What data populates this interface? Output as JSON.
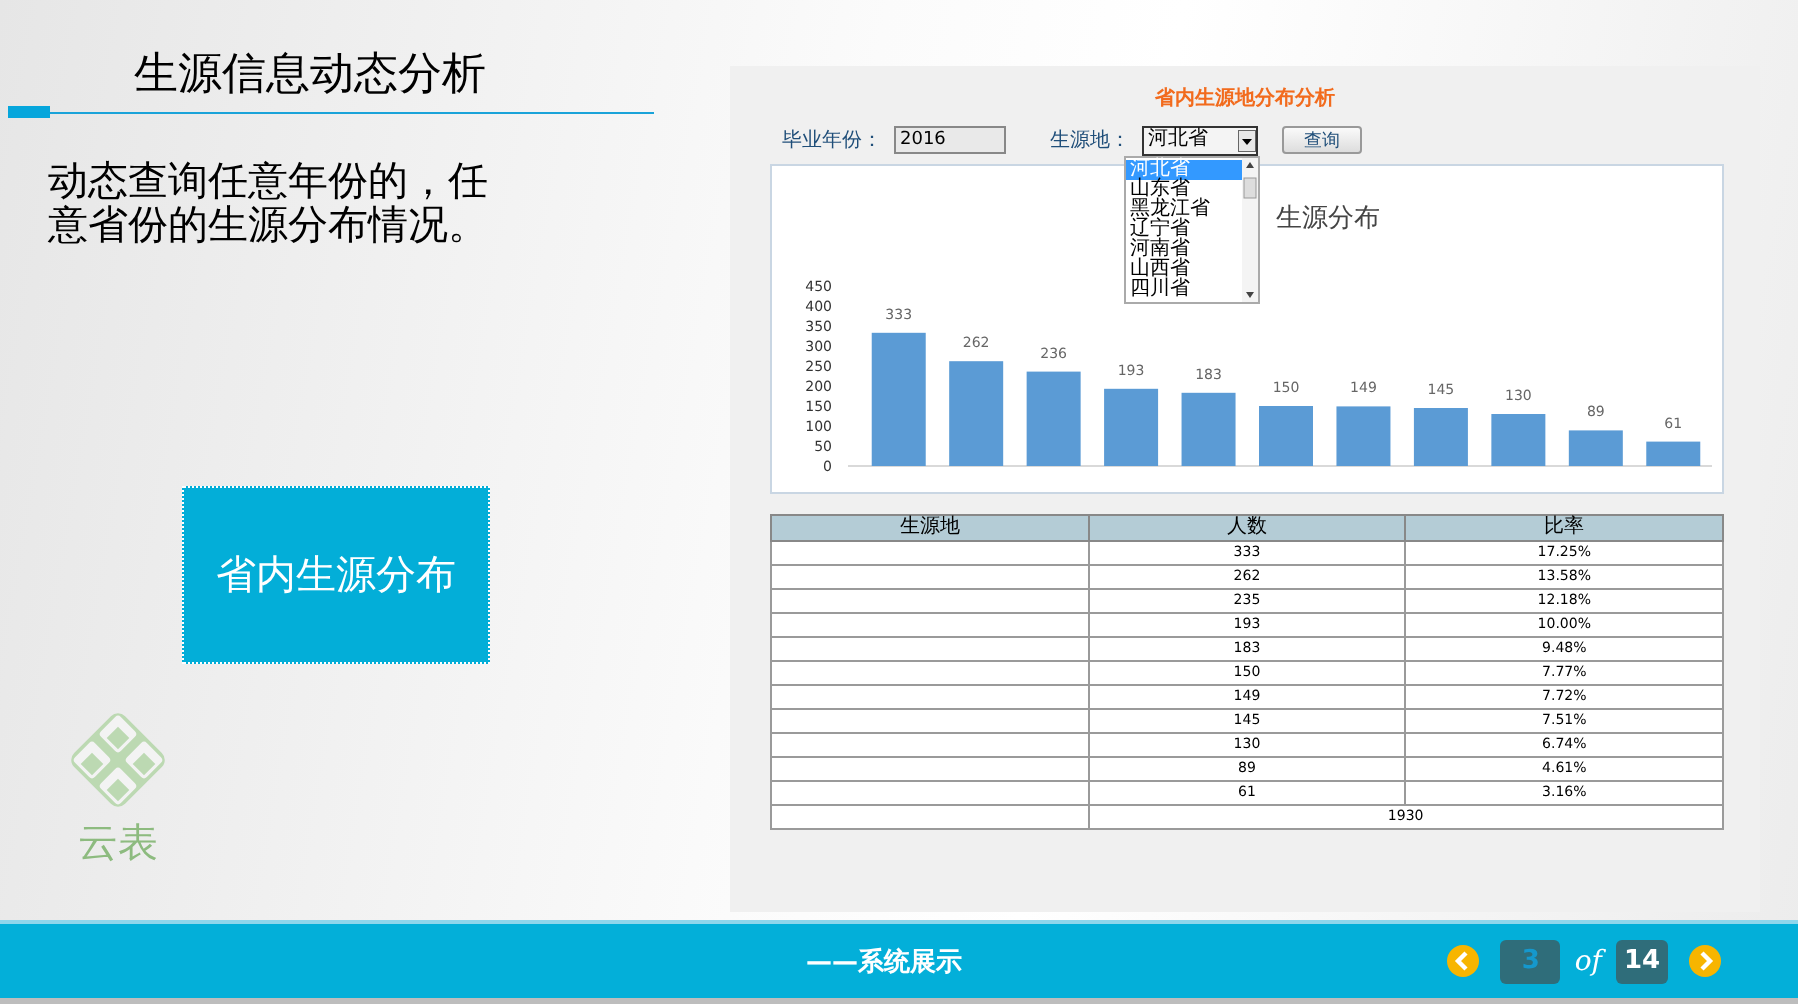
{
  "slide": {
    "title": "生源信息动态分析",
    "description": "动态查询任意年份的，任意省份的生源分布情况。",
    "highlight_box": "省内生源分布",
    "logo_text": "云表"
  },
  "app": {
    "title": "省内生源地分布分析",
    "year_label": "毕业年份：",
    "year_value": "2016",
    "origin_label": "生源地：",
    "origin_value": "河北省",
    "query_button": "查询",
    "dropdown": {
      "expanded": true,
      "items": [
        {
          "label": "河北省",
          "selected": true
        },
        {
          "label": "山东省",
          "selected": false
        },
        {
          "label": "黑龙江省",
          "selected": false
        },
        {
          "label": "辽宁省",
          "selected": false
        },
        {
          "label": "河南省",
          "selected": false
        },
        {
          "label": "山西省",
          "selected": false
        },
        {
          "label": "四川省",
          "selected": false
        }
      ]
    },
    "chart_data": {
      "type": "bar",
      "title": "生源分布",
      "values": [
        333,
        262,
        236,
        193,
        183,
        150,
        149,
        145,
        130,
        89,
        61
      ],
      "ylim": [
        0,
        450
      ],
      "yticks": [
        0,
        50,
        100,
        150,
        200,
        250,
        300,
        350,
        400,
        450
      ],
      "data_labels": true
    },
    "table": {
      "columns": [
        "生源地",
        "人数",
        "比率"
      ],
      "rows": [
        {
          "count": "333",
          "ratio": "17.25%"
        },
        {
          "count": "262",
          "ratio": "13.58%"
        },
        {
          "count": "235",
          "ratio": "12.18%"
        },
        {
          "count": "193",
          "ratio": "10.00%"
        },
        {
          "count": "183",
          "ratio": "9.48%"
        },
        {
          "count": "150",
          "ratio": "7.77%"
        },
        {
          "count": "149",
          "ratio": "7.72%"
        },
        {
          "count": "145",
          "ratio": "7.51%"
        },
        {
          "count": "130",
          "ratio": "6.74%"
        },
        {
          "count": "89",
          "ratio": "4.61%"
        },
        {
          "count": "61",
          "ratio": "3.16%"
        }
      ],
      "total": "1930"
    }
  },
  "footer": {
    "caption": "——系统展示",
    "page": "3",
    "of_label": "of",
    "total_pages": "14"
  }
}
